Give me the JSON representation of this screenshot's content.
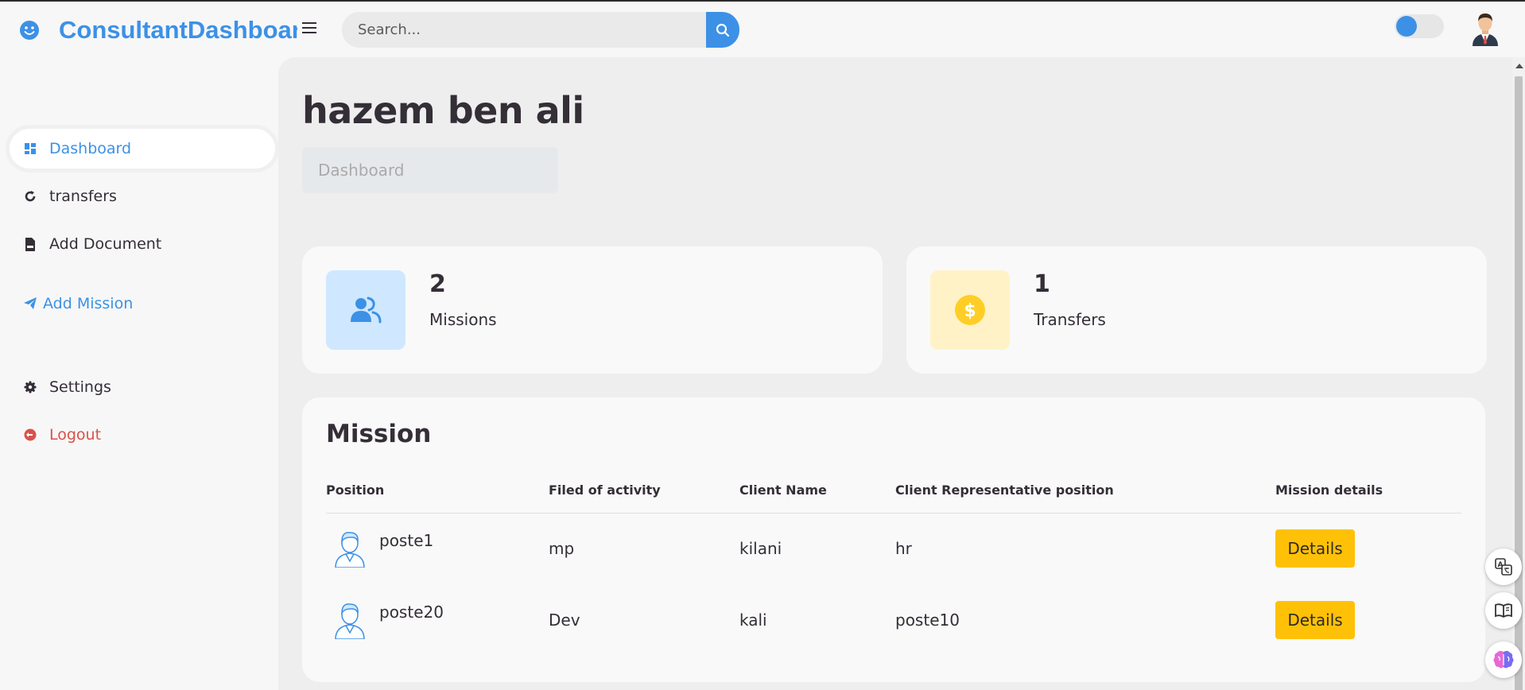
{
  "brand": {
    "name": "ConsultantDashboard",
    "color": "#3c91e6"
  },
  "search": {
    "placeholder": "Search..."
  },
  "sidebar": {
    "items": [
      {
        "label": "Dashboard",
        "icon": "dashboard-icon",
        "active": true
      },
      {
        "label": "transfers",
        "icon": "refresh-icon"
      },
      {
        "label": "Add Document",
        "icon": "document-icon"
      },
      {
        "label": "Add Mission",
        "icon": "send-icon"
      },
      {
        "label": "Settings",
        "icon": "gear-icon"
      },
      {
        "label": "Logout",
        "icon": "logout-icon"
      }
    ]
  },
  "header": {
    "title": "hazem ben ali",
    "breadcrumb": "Dashboard"
  },
  "stats": [
    {
      "value": "2",
      "label": "Missions",
      "icon": "users-icon",
      "bg": "#cfe8ff",
      "color": "#3c91e6"
    },
    {
      "value": "1",
      "label": "Transfers",
      "icon": "dollar-icon",
      "bg": "#fff2c6",
      "color": "#ffce26"
    }
  ],
  "missions": {
    "title": "Mission",
    "columns": [
      "Position",
      "Filed of activity",
      "Client Name",
      "Client Representative position",
      "Mission details"
    ],
    "rows": [
      {
        "position": "poste1",
        "field": "mp",
        "client": "kilani",
        "rep_position": "hr",
        "action": "Details"
      },
      {
        "position": "poste20",
        "field": "Dev",
        "client": "kali",
        "rep_position": "poste10",
        "action": "Details"
      }
    ]
  },
  "colors": {
    "accent": "#3c91e6",
    "danger": "#db504a",
    "warning": "#ffc107"
  }
}
